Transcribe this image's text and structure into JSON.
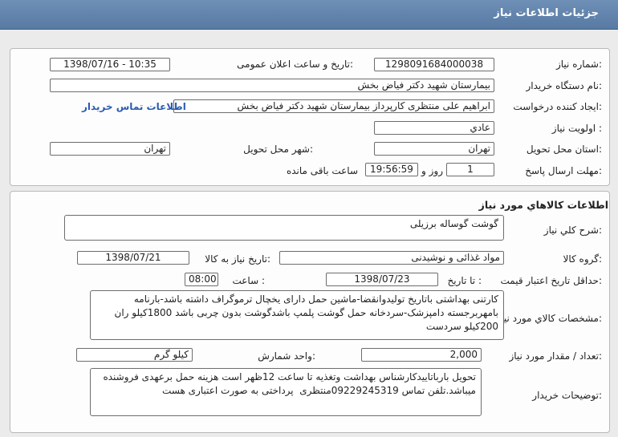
{
  "header": {
    "title": "جزئيات اطلاعات نياز"
  },
  "general": {
    "need_number_label": "شماره نياز:",
    "need_number": "1298091684000038",
    "announce_label": "تاريخ و ساعت اعلان عمومی:",
    "announce_value": "1398/07/16 - 10:35",
    "buyer_label": "نام دستگاه خريدار:",
    "buyer": "بيمارستان شهيد دکتر فياض بخش",
    "creator_label": "ايجاد کننده درخواست:",
    "creator": "ابراهيم علی منتظری کارپرداز بيمارستان شهيد دکتر فياض بخش",
    "contact_link": "اطلاعات تماس خريدار",
    "priority_label": "اولويت نياز :",
    "priority": "عادي",
    "province_label": "استان محل تحويل:",
    "province": "تهران",
    "city_label": "شهر محل تحويل:",
    "city": "تهران",
    "deadline_label": "مهلت ارسال پاسخ:",
    "deadline_days": "1",
    "days_and_label": "روز و",
    "deadline_time": "19:56:59",
    "remaining_label": "ساعت باقی مانده"
  },
  "goods": {
    "section_title": "اطلاعات کالاهاي مورد نياز",
    "summary_label": "شرح کلي نياز:",
    "summary": "گوشت گوساله برزيلی",
    "group_label": "گروه کالا:",
    "group": "مواد غذائی و نوشيدنی",
    "need_date_label": "تاريخ نياز به کالا:",
    "need_date": "1398/07/21",
    "validity_label": "حداقل تاريخ اعتبار قيمت:",
    "to_date_label": "تا تاريخ :",
    "validity_date": "1398/07/23",
    "hour_label": "ساعت :",
    "validity_time": "08:00",
    "specs_label": "مشخصات کالاي مورد نياز:",
    "specs": "کارتنی بهداشتی باتاريخ توليدوانقضا-ماشين حمل دارای يخچال ترموگراف داشته باشد-بارنامه بامهربرجسته دامپزشک-سردخانه حمل گوشت پلمپ باشدگوشت بدون چربی باشد 1800کيلو ران 200کيلو سردست",
    "quantity_label": "تعداد / مقدار مورد نياز:",
    "quantity": "2,000",
    "unit_label": "واحد شمارش:",
    "unit": "کيلو گرم",
    "notes_label": "توضيحات خريدار:",
    "notes": "تحويل بارباتاييدکارشناس بهداشت وتغذيه تا ساعت 12ظهر است هزينه حمل برعهدی فروشنده ميباشد.تلفن تماس 09229245319منتظری  پرداختی به صورت اعتباری هست"
  }
}
